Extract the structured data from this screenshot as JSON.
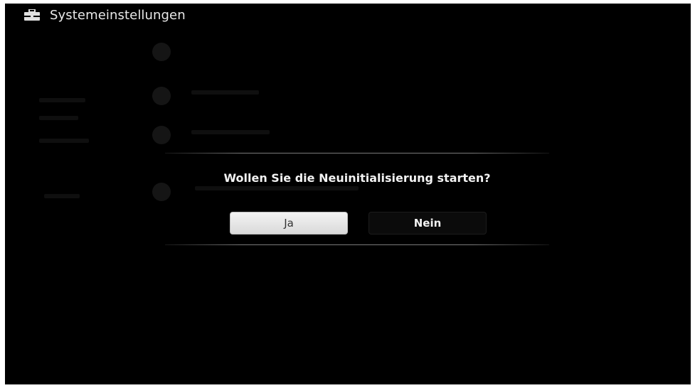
{
  "header": {
    "title": "Systemeinstellungen",
    "icon": "toolbox-icon"
  },
  "dialog": {
    "question": "Wollen Sie die Neuinitialisierung starten?",
    "yes_label": "Ja",
    "no_label": "Nein"
  },
  "colors": {
    "background": "#000000",
    "selected_button": "#e6e6e6",
    "text": "#f2f2f2"
  }
}
